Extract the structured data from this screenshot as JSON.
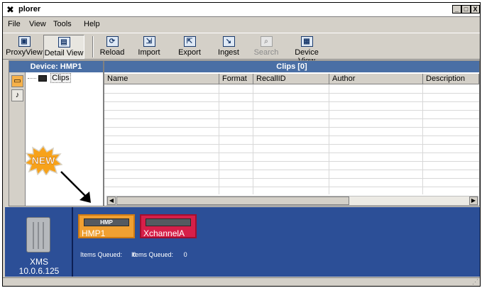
{
  "window": {
    "title": "plorer",
    "title_icon": "x-logo-icon",
    "controls": [
      "_",
      "□",
      "X"
    ]
  },
  "menu": [
    "File",
    "View",
    "Tools",
    "Help"
  ],
  "toolbar": {
    "proxyview": "ProxyView",
    "detailview": "Detail View",
    "reload": "Reload",
    "import": "Import",
    "export": "Export",
    "ingest": "Ingest",
    "search": "Search",
    "deviceview": "Device View"
  },
  "device_panel": {
    "title": "Device: HMP1",
    "tree_item": "Clips",
    "side_icons": [
      "film-icon",
      "music-note-icon"
    ]
  },
  "clips_panel": {
    "title": "Clips [0]",
    "columns": [
      "Name",
      "Format",
      "RecallID",
      "Author",
      "Description"
    ]
  },
  "annotation": {
    "badge": "NEW"
  },
  "xms": {
    "name": "XMS",
    "ip": "10.0.6.125"
  },
  "devices": [
    {
      "name": "HMP1",
      "rack_label": "HMP",
      "color": "#f0a032",
      "selected": true
    },
    {
      "name": "XchannelA",
      "rack_label": "",
      "color": "#d61f49",
      "selected": false
    }
  ],
  "queues": [
    {
      "label": "Items Queued:",
      "count": "0"
    },
    {
      "label": "Items Queued:",
      "count": "0"
    }
  ],
  "colors": {
    "panel_header": "#4a6fa5",
    "bottom_bar": "#2c4f97",
    "badge_fill": "#f7a21a"
  }
}
